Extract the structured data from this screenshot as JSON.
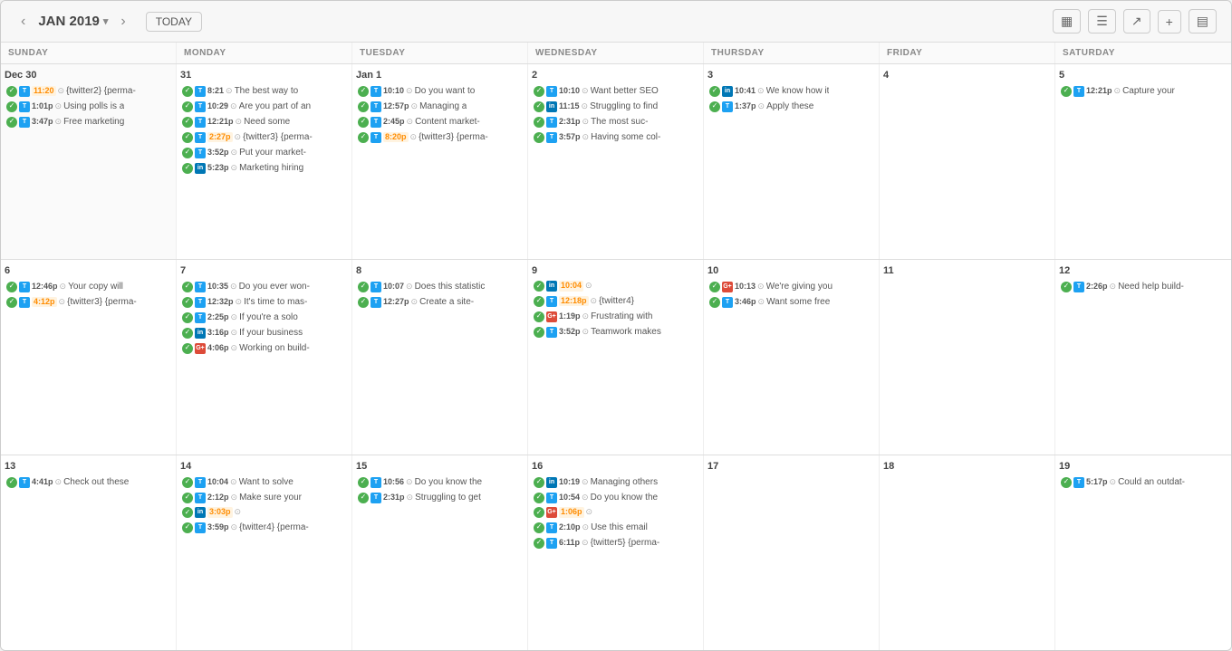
{
  "header": {
    "prev_label": "‹",
    "next_label": "›",
    "month_title": "JAN 2019",
    "dropdown_icon": "▾",
    "today_label": "TODAY",
    "tool_calendar": "▦",
    "tool_list": "☰",
    "tool_share": "↗",
    "tool_add": "+",
    "tool_settings": "▤"
  },
  "day_headers": [
    "SUNDAY",
    "MONDAY",
    "TUESDAY",
    "WEDNESDAY",
    "THURSDAY",
    "FRIDAY",
    "SATURDAY"
  ],
  "weeks": [
    {
      "days": [
        {
          "num": "Dec 30",
          "other": true,
          "events": [
            {
              "check": "done",
              "social": "tw",
              "time": "11:20",
              "time_style": "orange",
              "clock": true,
              "text": "{twitter2} {perma-"
            },
            {
              "check": "done",
              "social": "tw",
              "time": "1:01p",
              "clock": true,
              "text": "Using polls is a"
            },
            {
              "check": "done",
              "social": "tw",
              "time": "3:47p",
              "clock": true,
              "text": "Free marketing"
            }
          ]
        },
        {
          "num": "31",
          "events": [
            {
              "check": "done",
              "social": "tw",
              "time": "8:21",
              "clock": true,
              "text": "The best way to"
            },
            {
              "check": "done",
              "social": "tw",
              "time": "10:29",
              "clock": true,
              "text": "Are you part of an"
            },
            {
              "check": "done",
              "social": "tw",
              "time": "12:21p",
              "clock": true,
              "text": "Need some"
            },
            {
              "check": "done",
              "social": "tw",
              "time": "2:27p",
              "time_style": "orange",
              "clock": true,
              "text": "{twitter3} {perma-",
              "highlight": true
            },
            {
              "check": "done",
              "social": "tw",
              "time": "3:52p",
              "clock": true,
              "text": "Put your market-"
            },
            {
              "check": "done",
              "social": "li",
              "time": "5:23p",
              "clock": true,
              "text": "Marketing hiring"
            }
          ]
        },
        {
          "num": "Jan 1",
          "events": [
            {
              "check": "done",
              "social": "tw",
              "time": "10:10",
              "clock": true,
              "text": "Do you want to"
            },
            {
              "check": "done",
              "social": "tw",
              "time": "12:57p",
              "clock": true,
              "text": "Managing a"
            },
            {
              "check": "done",
              "social": "tw",
              "time": "2:45p",
              "clock": true,
              "text": "Content market-"
            },
            {
              "check": "done",
              "social": "tw",
              "time": "8:20p",
              "time_style": "orange",
              "clock": true,
              "text": "{twitter3} {perma-",
              "highlight": true
            }
          ]
        },
        {
          "num": "2",
          "events": [
            {
              "check": "done",
              "social": "tw",
              "time": "10:10",
              "clock": true,
              "text": "Want better SEO"
            },
            {
              "check": "done",
              "social": "li",
              "time": "11:15",
              "clock": true,
              "text": "Struggling to find"
            },
            {
              "check": "done",
              "social": "tw",
              "time": "2:31p",
              "clock": true,
              "text": "The most suc-"
            },
            {
              "check": "done",
              "social": "tw",
              "time": "3:57p",
              "clock": true,
              "text": "Having some col-"
            }
          ]
        },
        {
          "num": "3",
          "events": [
            {
              "check": "done",
              "social": "li",
              "time": "10:41",
              "clock": true,
              "text": "We know how it"
            },
            {
              "check": "done",
              "social": "tw",
              "time": "1:37p",
              "clock": true,
              "text": "Apply these"
            }
          ]
        },
        {
          "num": "4",
          "events": []
        },
        {
          "num": "5",
          "events": [
            {
              "check": "done",
              "social": "tw",
              "time": "12:21p",
              "clock": true,
              "text": "Capture your"
            }
          ]
        }
      ]
    },
    {
      "days": [
        {
          "num": "6",
          "events": [
            {
              "check": "done",
              "social": "tw",
              "time": "12:46p",
              "clock": true,
              "text": "Your copy will"
            },
            {
              "check": "done",
              "social": "tw",
              "time": "4:12p",
              "time_style": "orange",
              "clock": true,
              "text": "{twitter3} {perma-"
            }
          ]
        },
        {
          "num": "7",
          "events": [
            {
              "check": "done",
              "social": "tw",
              "time": "10:35",
              "clock": true,
              "text": "Do you ever won-"
            },
            {
              "check": "done",
              "social": "tw",
              "time": "12:32p",
              "clock": true,
              "text": "It's time to mas-"
            },
            {
              "check": "done",
              "social": "tw",
              "time": "2:25p",
              "clock": true,
              "text": "If you're a solo"
            },
            {
              "check": "done",
              "social": "li",
              "time": "3:16p",
              "clock": true,
              "text": "If your business"
            },
            {
              "check": "done",
              "social": "gp",
              "time": "4:06p",
              "clock": true,
              "text": "Working on build-"
            }
          ]
        },
        {
          "num": "8",
          "events": [
            {
              "check": "done",
              "social": "tw",
              "time": "10:07",
              "clock": true,
              "text": "Does this statistic"
            },
            {
              "check": "done",
              "social": "tw",
              "time": "12:27p",
              "clock": true,
              "text": "Create a site-"
            }
          ]
        },
        {
          "num": "9",
          "events": [
            {
              "check": "done",
              "social": "li",
              "time": "10:04",
              "time_style": "orange",
              "clock": true,
              "text": "",
              "highlight": true
            },
            {
              "check": "done",
              "social": "tw",
              "time": "12:18p",
              "time_style": "orange",
              "clock": true,
              "text": "{twitter4}"
            },
            {
              "check": "done",
              "social": "gp",
              "time": "1:19p",
              "clock": true,
              "text": "Frustrating with"
            },
            {
              "check": "done",
              "social": "tw",
              "time": "3:52p",
              "clock": true,
              "text": "Teamwork makes"
            }
          ]
        },
        {
          "num": "10",
          "events": [
            {
              "check": "done",
              "social": "gp",
              "time": "10:13",
              "clock": true,
              "text": "We're giving you"
            },
            {
              "check": "done",
              "social": "tw",
              "time": "3:46p",
              "clock": true,
              "text": "Want some free"
            }
          ]
        },
        {
          "num": "11",
          "events": []
        },
        {
          "num": "12",
          "events": [
            {
              "check": "done",
              "social": "tw",
              "time": "2:26p",
              "clock": true,
              "text": "Need help build-"
            }
          ]
        }
      ]
    },
    {
      "days": [
        {
          "num": "13",
          "events": [
            {
              "check": "done",
              "social": "tw",
              "time": "4:41p",
              "clock": true,
              "text": "Check out these"
            }
          ]
        },
        {
          "num": "14",
          "events": [
            {
              "check": "done",
              "social": "tw",
              "time": "10:04",
              "clock": true,
              "text": "Want to solve"
            },
            {
              "check": "done",
              "social": "tw",
              "time": "2:12p",
              "clock": true,
              "text": "Make sure your"
            },
            {
              "check": "done",
              "social": "li",
              "time": "3:03p",
              "time_style": "orange",
              "clock": true,
              "text": "",
              "highlight": true
            },
            {
              "check": "done",
              "social": "tw",
              "time": "3:59p",
              "clock": true,
              "text": "{twitter4} {perma-"
            }
          ]
        },
        {
          "num": "15",
          "events": [
            {
              "check": "done",
              "social": "tw",
              "time": "10:56",
              "clock": true,
              "text": "Do you know the"
            },
            {
              "check": "done",
              "social": "tw",
              "time": "2:31p",
              "clock": true,
              "text": "Struggling to get"
            }
          ]
        },
        {
          "num": "16",
          "events": [
            {
              "check": "done",
              "social": "li",
              "time": "10:19",
              "clock": true,
              "text": "Managing others"
            },
            {
              "check": "done",
              "social": "tw",
              "time": "10:54",
              "clock": true,
              "text": "Do you know the"
            },
            {
              "check": "done",
              "social": "gp",
              "time": "1:06p",
              "time_style": "orange",
              "clock": true,
              "text": "",
              "highlight": true
            },
            {
              "check": "done",
              "social": "tw",
              "time": "2:10p",
              "clock": true,
              "text": "Use this email"
            },
            {
              "check": "done",
              "social": "tw",
              "time": "6:11p",
              "clock": true,
              "text": "{twitter5} {perma-"
            }
          ]
        },
        {
          "num": "17",
          "addBtn": true,
          "events": []
        },
        {
          "num": "18",
          "events": []
        },
        {
          "num": "19",
          "events": [
            {
              "check": "done",
              "social": "tw",
              "time": "5:17p",
              "clock": true,
              "text": "Could an outdat-"
            }
          ]
        }
      ]
    }
  ]
}
